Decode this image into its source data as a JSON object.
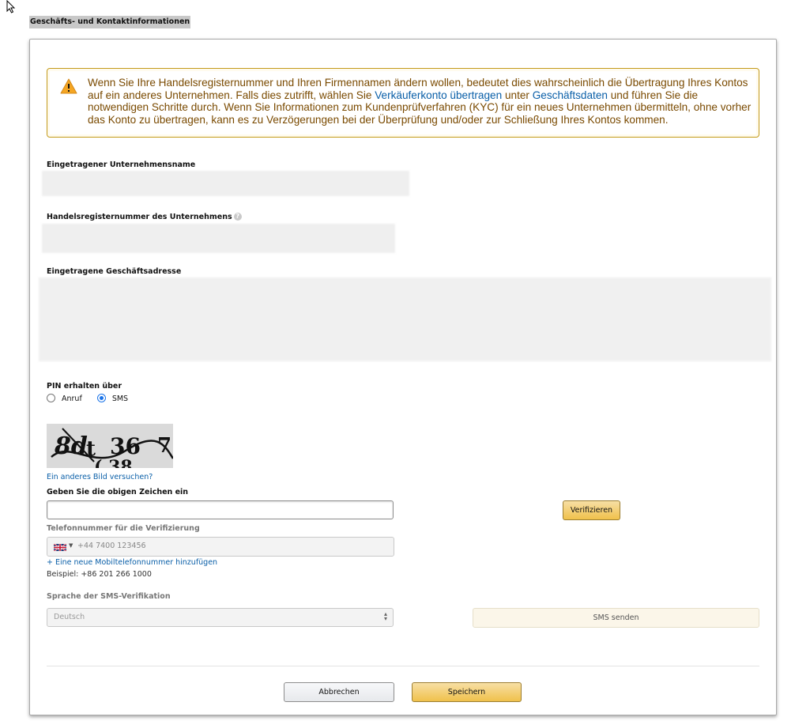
{
  "page": {
    "heading": "Geschäfts- und Kontaktinformationen"
  },
  "alert": {
    "text_1": "Wenn Sie Ihre Handelsregisternummer und Ihren Firmennamen ändern wollen, bedeutet dies wahrscheinlich die Übertragung Ihres Kontos auf ein anderes Unternehmen. Falls dies zutrifft, wählen Sie ",
    "link_1": "Verkäuferkonto übertragen",
    "text_2": " unter ",
    "link_2": "Geschäftsdaten",
    "text_3": " und führen Sie die notwendigen Schritte durch. Wenn Sie Informationen zum Kundenprüfverfahren (KYC) für ein neues Unternehmen übermitteln, ohne vorher das Konto zu übertragen, kann es zu Verzögerungen bei der Überprüfung und/oder zur Schließung Ihres Kontos kommen."
  },
  "form": {
    "company_name_label": "Eingetragener Unternehmensname",
    "registration_number_label": "Handelsregisternummer des Unternehmens",
    "address_label": "Eingetragene Geschäftsadresse",
    "pin_label": "PIN erhalten über",
    "pin_options": [
      "Anruf",
      "SMS"
    ],
    "pin_selected": "SMS",
    "captcha_text": "8d t 36 7",
    "captcha_refresh_link": "Ein anderes Bild versuchen?",
    "captcha_input_label": "Geben Sie die obigen Zeichen ein",
    "captcha_input_value": "",
    "verify_button": "Verifizieren",
    "phone_label": "Telefonnummer für die Verifizierung",
    "phone_placeholder": "+44 7400 123456",
    "add_phone_link": "+ Eine neue Mobiltelefonnummer hinzufügen",
    "phone_example": "Beispiel: +86 201 266 1000",
    "sms_language_label": "Sprache der SMS-Verifikation",
    "sms_language_value": "Deutsch",
    "send_sms_button": "SMS senden"
  },
  "footer": {
    "cancel_button": "Abbrechen",
    "save_button": "Speichern"
  },
  "colors": {
    "alert_border": "#c39a1a",
    "alert_text": "#7a4a00",
    "link": "#0a5fa8",
    "primary_button": "#f0c14b"
  }
}
